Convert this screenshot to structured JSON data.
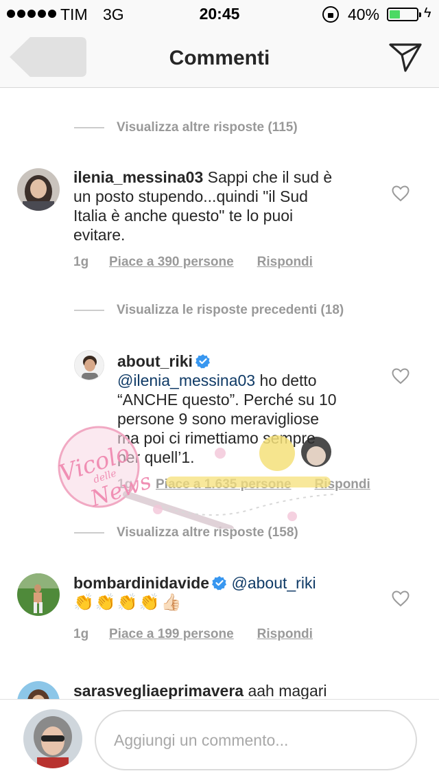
{
  "status_bar": {
    "carrier": "TIM",
    "network": "3G",
    "time": "20:45",
    "battery_percent": "40%",
    "battery_level": 0.4,
    "battery_color": "#4cd964"
  },
  "nav": {
    "back_icon": "back-arrow-icon",
    "title": "Commenti",
    "send_icon": "paper-plane-icon"
  },
  "threads": [
    {
      "more_label": "Visualizza altre risposte (115)"
    },
    {
      "username": "ilenia_messina03",
      "text_lines": [
        " Sappi che il sud è",
        "un posto stupendo...quindi \"il Sud",
        "Italia è anche questo\" te lo puoi",
        "evitare."
      ],
      "age": "1g",
      "likes": "Piace a 390 persone",
      "reply": "Rispondi"
    },
    {
      "more_label": "Visualizza le risposte precedenti (18)"
    },
    {
      "username": "about_riki",
      "verified": true,
      "mention": "@ilenia_messina03",
      "text_lines": [
        " ho detto",
        "“ANCHE questo”. Perché su 10",
        "persone 9 sono meravigliose",
        "ma poi ci rimettiamo sempre",
        "per quell’1."
      ],
      "age": "1g",
      "likes": "Piace a 1.635 persone",
      "reply": "Rispondi"
    },
    {
      "more_label": "Visualizza altre risposte (158)"
    },
    {
      "username": "bombardinidavide",
      "verified": true,
      "mention": "@about_riki",
      "emojis": [
        "👏",
        "👏",
        "👏",
        "👏",
        "👍🏻"
      ],
      "age": "1g",
      "likes": "Piace a 199 persone",
      "reply": "Rispondi"
    },
    {
      "username": "sarasvegliaeprimavera",
      "text": " aah magari"
    }
  ],
  "watermark": {
    "line1": "Vicolo",
    "line2": "delle",
    "line3": "News"
  },
  "compose": {
    "placeholder": "Aggiungi un commento..."
  },
  "colors": {
    "mention": "#0f3a66",
    "verified": "#3897f0",
    "meta": "#9a9a9a"
  }
}
